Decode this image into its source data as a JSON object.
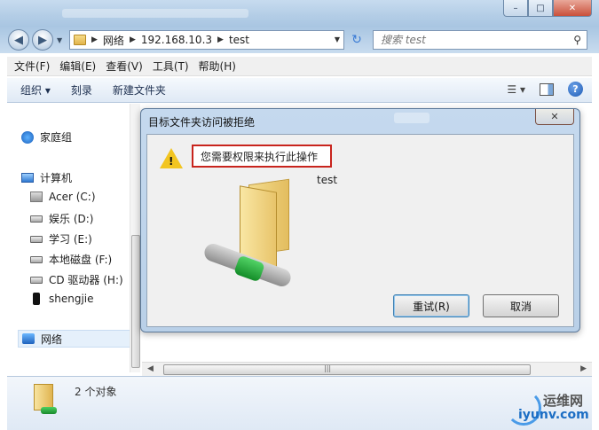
{
  "navigation": {
    "breadcrumbs": [
      "网络",
      "192.168.10.3",
      "test"
    ],
    "search_placeholder": "搜索 test"
  },
  "menu": {
    "items": [
      "文件(F)",
      "编辑(E)",
      "查看(V)",
      "工具(T)",
      "帮助(H)"
    ]
  },
  "toolbar": {
    "organize_label": "组织 ▾",
    "burn_label": "刻录",
    "new_folder_label": "新建文件夹"
  },
  "sidebar": {
    "homegroup": "家庭组",
    "computer": "计算机",
    "drives": [
      "Acer (C:)",
      "娱乐 (D:)",
      "学习 (E:)",
      "本地磁盘 (F:)",
      "CD 驱动器 (H:)",
      "shengjie"
    ],
    "network": "网络"
  },
  "status": {
    "item_count": "2 个对象"
  },
  "dialog": {
    "title": "目标文件夹访问被拒绝",
    "message": "您需要权限来执行此操作",
    "item_name": "test",
    "retry_label": "重试(R)",
    "cancel_label": "取消"
  },
  "watermark": {
    "text": "运维网",
    "url": "iyunv.com"
  },
  "colors": {
    "highlight_border": "#c8241d",
    "title_glass": "#b3cde6"
  }
}
